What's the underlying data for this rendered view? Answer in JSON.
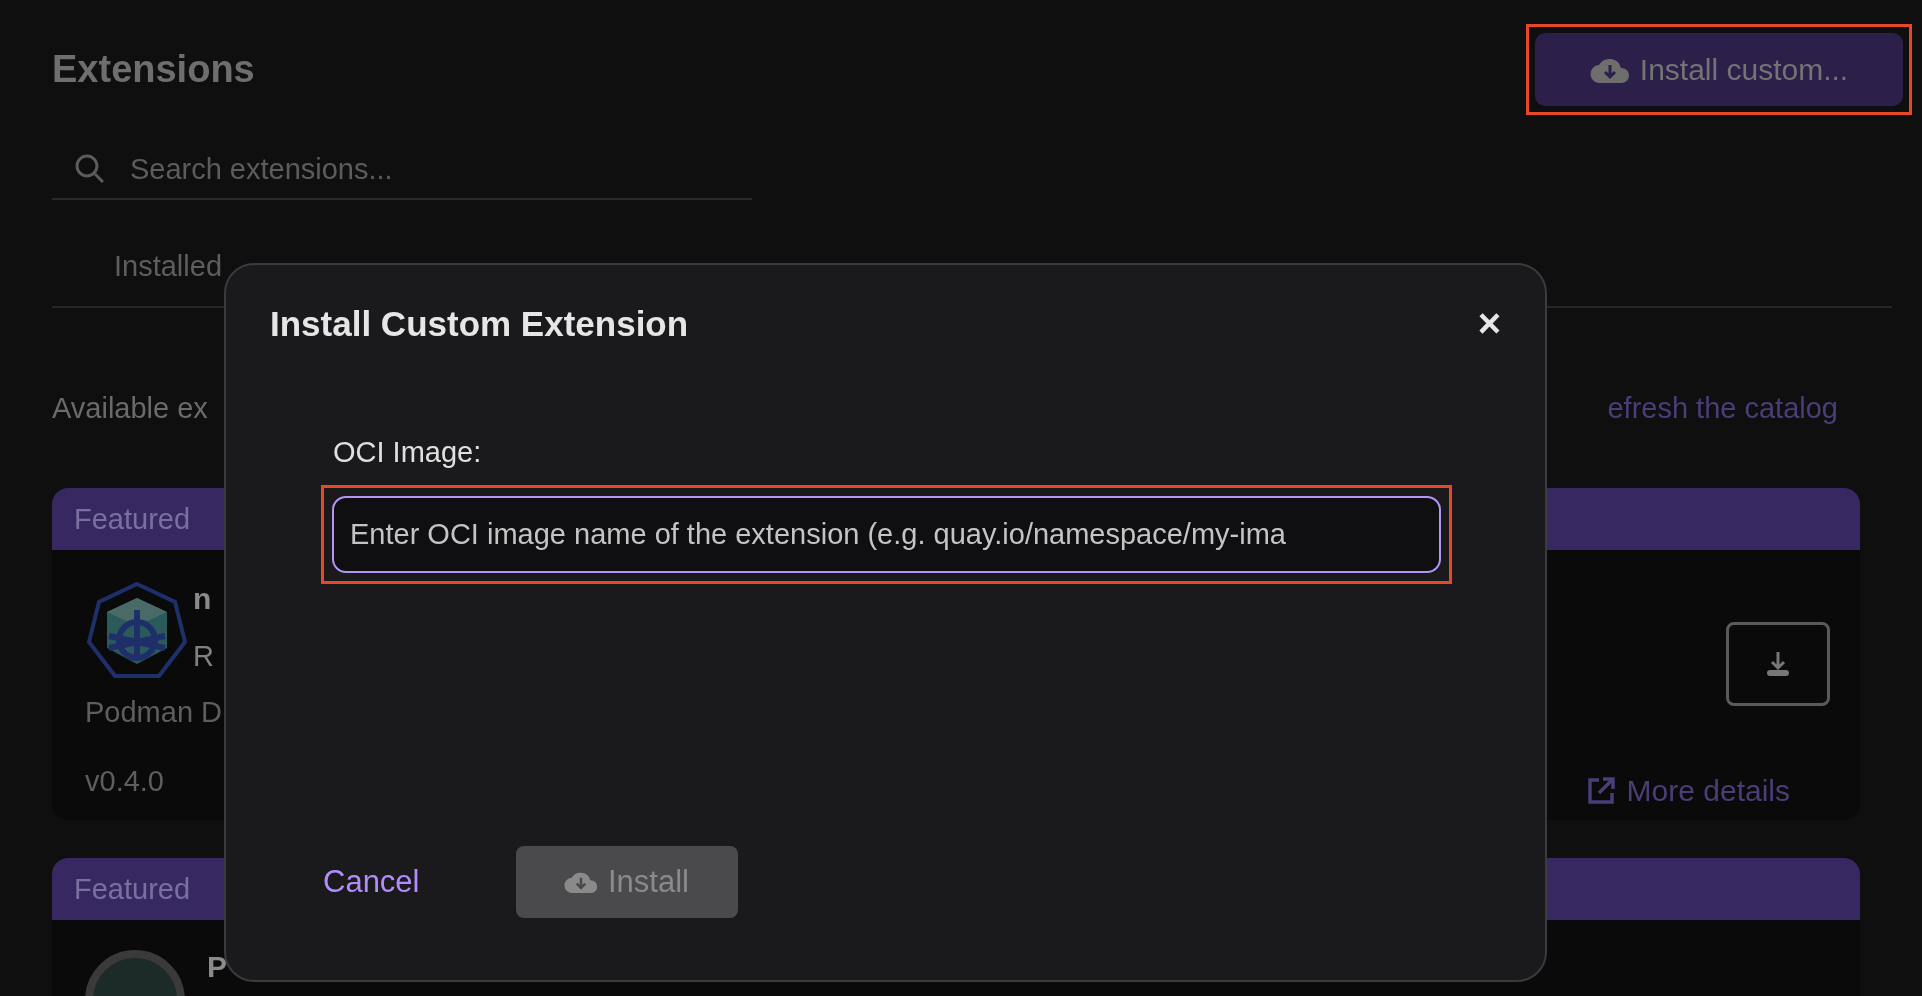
{
  "page": {
    "title": "Extensions",
    "install_custom_button": {
      "label": "Install custom...",
      "highlighted": true
    },
    "search": {
      "placeholder": "Search extensions..."
    },
    "tabs": [
      {
        "label": "Installed",
        "selected": false
      }
    ],
    "available_text": "Available ex",
    "refresh_link": "efresh the catalog",
    "cards": [
      {
        "banner": "Featured",
        "kind": "full",
        "name": "n",
        "subtitle": "R",
        "publisher": "Podman D",
        "version": "v0.4.0",
        "more_details": "More details"
      },
      {
        "banner": "Featured",
        "kind": "partial",
        "name": "P"
      }
    ]
  },
  "dialog": {
    "title": "Install Custom Extension",
    "close": "×",
    "field_label": "OCI Image:",
    "field": {
      "placeholder": "Enter OCI image name of the extension (e.g. quay.io/namespace/my-ima",
      "highlighted": true
    },
    "cancel": "Cancel",
    "install": {
      "label": "Install",
      "disabled": true
    }
  }
}
